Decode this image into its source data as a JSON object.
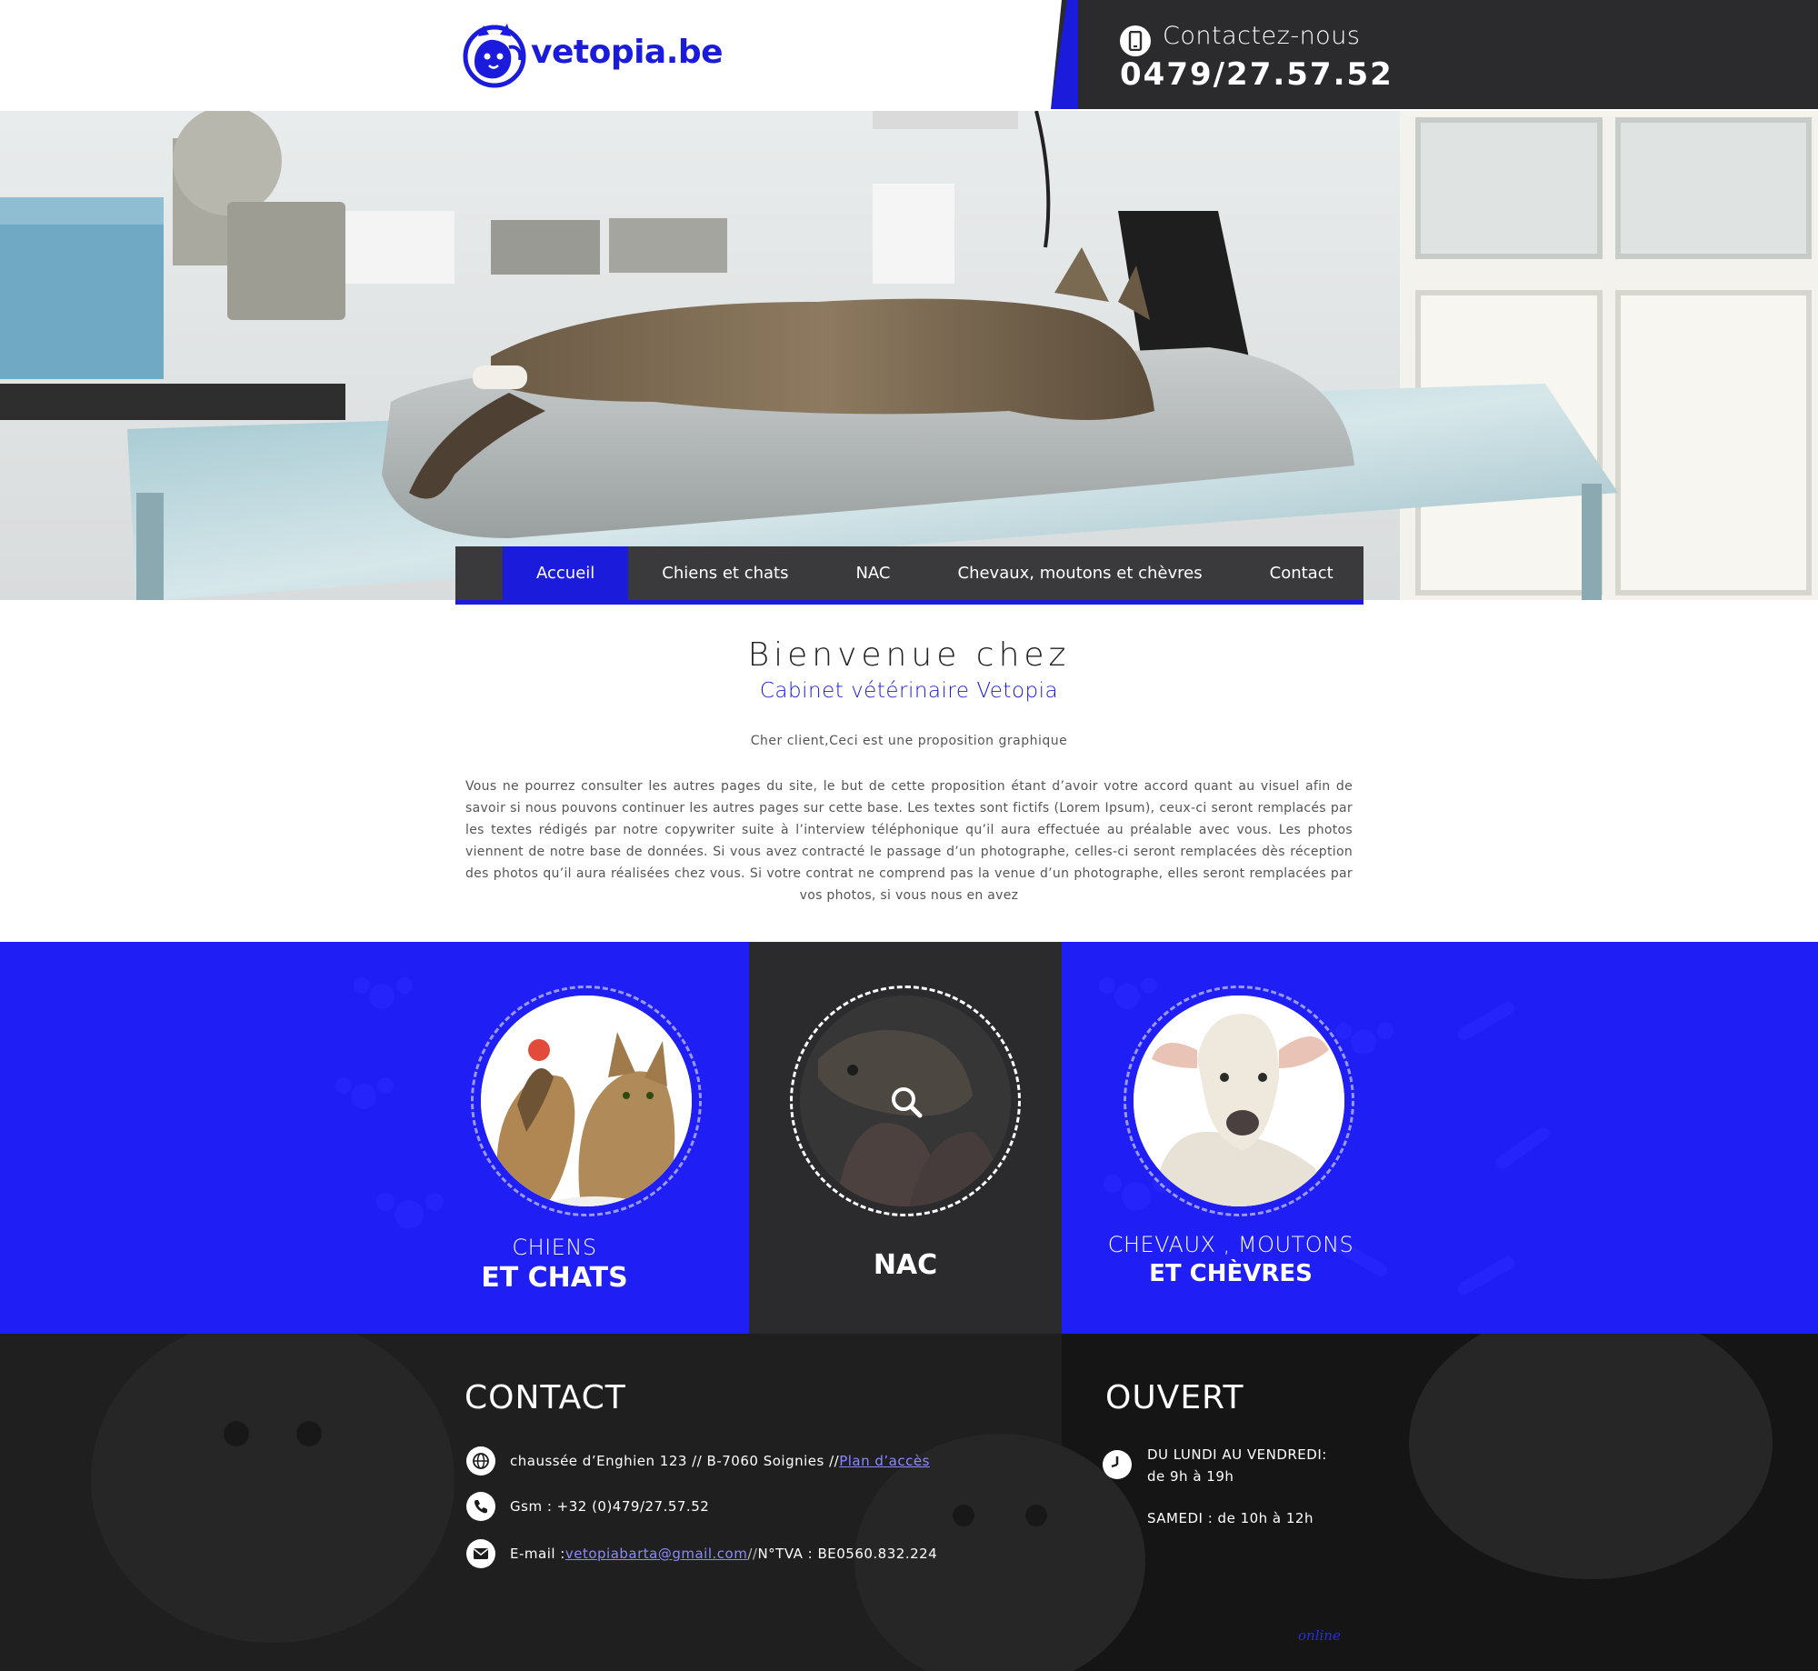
{
  "brand": {
    "name": "vetopia.be",
    "color": "#1b1bdc"
  },
  "header": {
    "contact_label": "Contactez-nous",
    "contact_number": "0479/27.57.52"
  },
  "hero": {
    "slides_count": 3,
    "active_slide": 2
  },
  "nav": {
    "items": [
      {
        "label": "Accueil",
        "active": true
      },
      {
        "label": "Chiens et chats",
        "active": false
      },
      {
        "label": "NAC",
        "active": false
      },
      {
        "label": "Chevaux, moutons et chèvres",
        "active": false
      },
      {
        "label": "Contact",
        "active": false
      }
    ]
  },
  "welcome": {
    "title": "Bienvenue chez",
    "subtitle": "Cabinet vétérinaire Vetopia",
    "intro": "Cher client,Ceci est  une proposition graphique",
    "body": "Vous ne pourrez consulter les autres pages du site, le but de cette proposition étant d’avoir votre accord quant au visuel afin de savoir si nous pouvons continuer les autres pages sur cette base. Les textes sont fictifs (Lorem Ipsum), ceux-ci seront remplacés par les textes rédigés par notre copywriter suite à l’interview téléphonique qu’il aura effectuée au préalable avec vous. Les photos viennent de notre base de données. Si vous avez contracté le passage d’un photographe, celles-ci seront remplacées dès réception des photos qu’il aura réalisées chez vous. Si votre contrat ne comprend pas la venue d’un photographe, elles seront remplacées par vos photos, si vous nous en avez"
  },
  "categories": [
    {
      "line1": "CHIENS",
      "line2": "ET CHATS",
      "icon": "dog-cat-photo"
    },
    {
      "line1": "",
      "line2": "NAC",
      "icon": "hamster-photo"
    },
    {
      "line1": "CHEVAUX , MOUTONS",
      "line2": "ET CHÈVRES",
      "icon": "lamb-photo"
    }
  ],
  "contact": {
    "title": "CONTACT",
    "address": "chaussée d’Enghien 123 // B-7060 Soignies // ",
    "map_link": "Plan d’accès",
    "gsm": "Gsm : +32 (0)479/27.57.52",
    "email_label": "E-mail : ",
    "email": "vetopiabarta@gmail.com",
    "vat_sep": " // ",
    "vat": "N°TVA : BE0560.832.224"
  },
  "hours": {
    "title": "OUVERT",
    "weekday_label": "DU LUNDI AU VENDREDI:",
    "weekday_hours": "de 9h à 19h",
    "saturday": "SAMEDI : de 10h à 12h"
  },
  "footer": {
    "signature": "online"
  },
  "colors": {
    "accent": "#1b1bdc",
    "categories_bg": "#1e1ef5",
    "dark": "#2b2b2d"
  }
}
